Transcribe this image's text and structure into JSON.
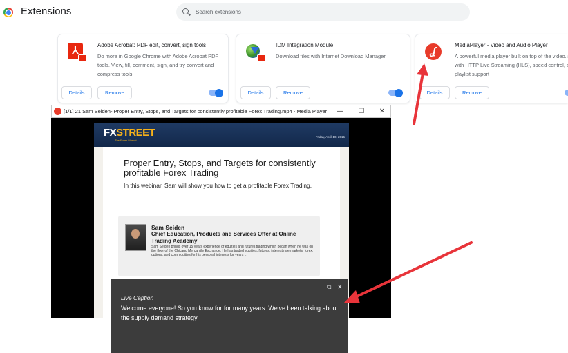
{
  "header": {
    "title": "Extensions",
    "search_placeholder": "Search extensions"
  },
  "extensions": [
    {
      "name": "Adobe Acrobat: PDF edit, convert, sign tools",
      "description": "Do more in Google Chrome with Adobe Acrobat PDF tools. View, fill, comment, sign, and try convert and compress tools.",
      "details_label": "Details",
      "remove_label": "Remove",
      "enabled": true,
      "icon": "adobe-acrobat-icon"
    },
    {
      "name": "IDM Integration Module",
      "description": "Download files with Internet Download Manager",
      "details_label": "Details",
      "remove_label": "Remove",
      "enabled": true,
      "icon": "idm-icon"
    },
    {
      "name": "MediaPlayer - Video and Audio Player",
      "description": "A powerful media player built on top of the video.js project with HTTP Live Streaming (HLS), speed control, and playlist support",
      "details_label": "Details",
      "remove_label": "Remove",
      "enabled": true,
      "icon": "media-player-icon"
    }
  ],
  "player": {
    "window_title": "[1/1] 21 Sam Seiden- Proper Entry, Stops, and Targets for consistently profitable Forex Trading.mp4 - Media Player",
    "minimize_glyph": "—",
    "maximize_glyph": "☐",
    "close_glyph": "✕",
    "slide": {
      "brand_main": "FX",
      "brand_accent": "STREET",
      "brand_tagline": "The Forex Market",
      "date": "Friday, April 10, 2015",
      "title": "Proper Entry, Stops, and Targets for consistently profitable Forex Trading",
      "subtitle": "In this webinar, Sam will show you how to get a profitable Forex Trading.",
      "speaker_name": "Sam Seiden",
      "speaker_role": "Chief Education, Products and Services Offer at Online Trading Academy",
      "speaker_bio": "Sam Seiden brings over 15 years experience of equities and futures trading which began when he was on the floor of the Chicago Mercantile Exchange. He has traded equities, futures, interest rate markets, forex, options, and commodities for his personal interests for years ..."
    }
  },
  "live_caption": {
    "heading": "Live Caption",
    "text": "Welcome everyone! So you know for for many years. We've been talking about the supply demand strategy",
    "popout_glyph": "⧉",
    "close_glyph": "✕"
  },
  "colors": {
    "accent": "#1a73e8",
    "annotation_arrow": "#e8343a",
    "caption_bg": "#3c3c3c"
  }
}
